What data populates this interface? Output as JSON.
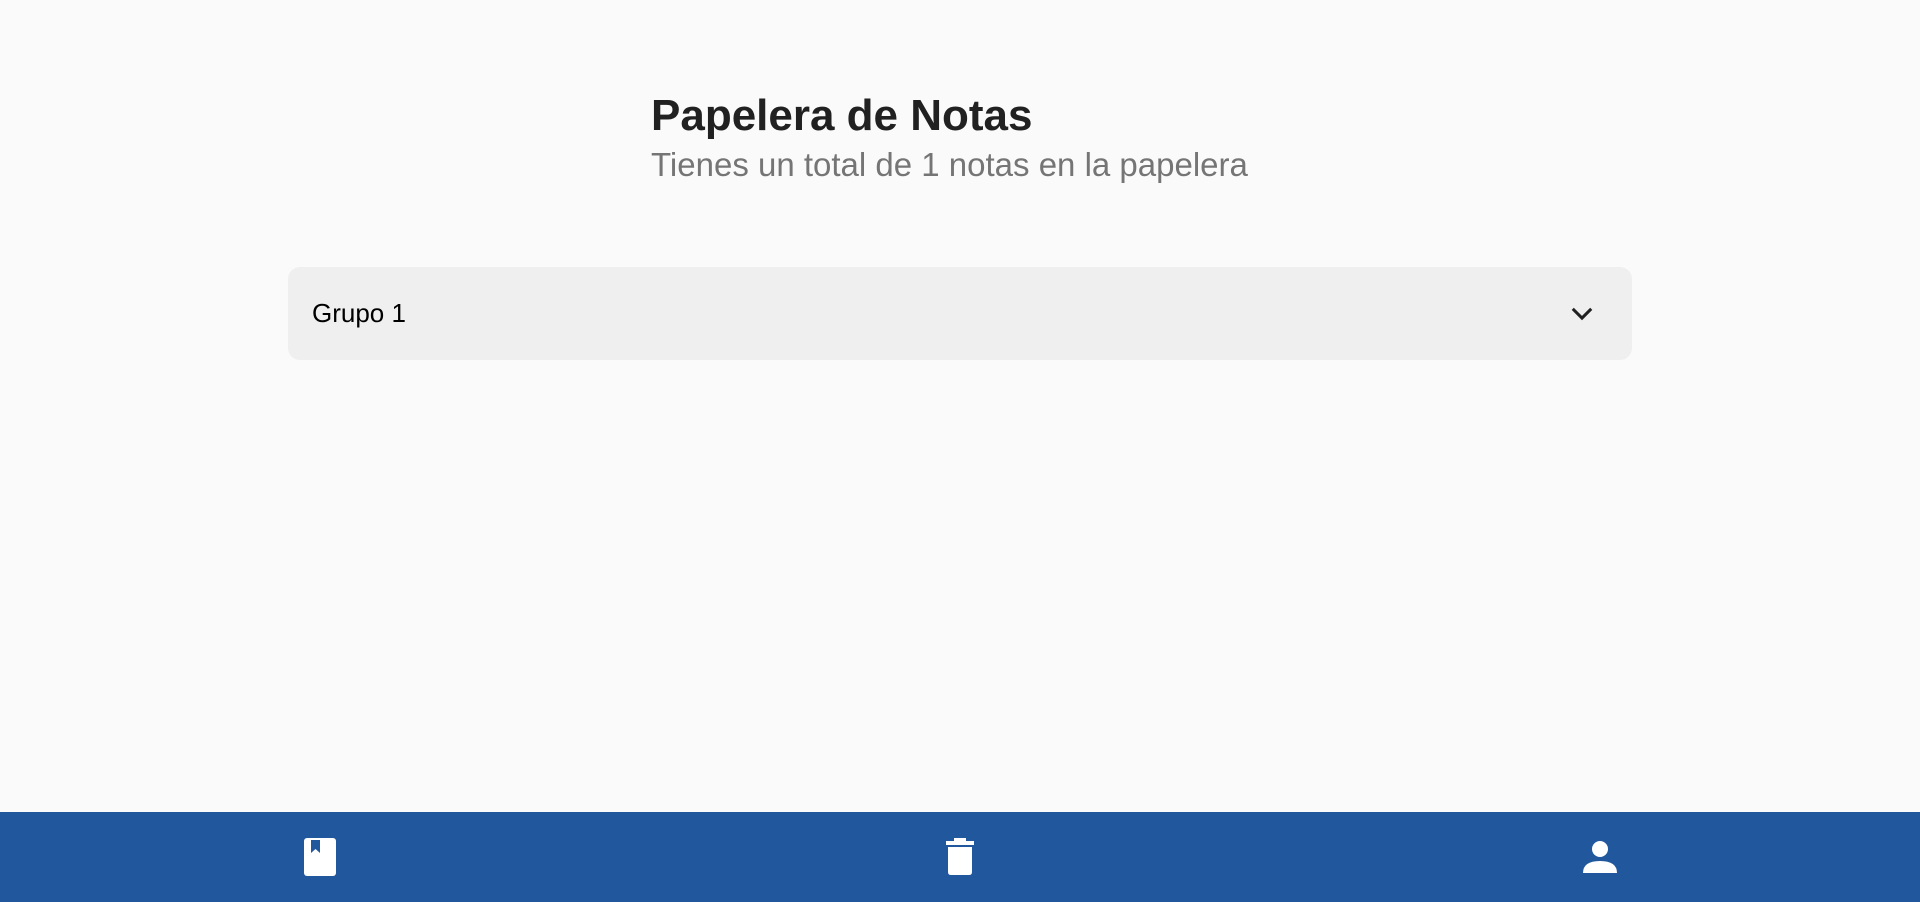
{
  "header": {
    "title": "Papelera de Notas",
    "subtitle": "Tienes un total de 1 notas en la papelera"
  },
  "groups": [
    {
      "title": "Grupo 1",
      "icon": "chevron-down-icon",
      "expanded": false
    }
  ],
  "bottom_nav": {
    "items": [
      {
        "icon": "notebook-icon"
      },
      {
        "icon": "trash-icon"
      },
      {
        "icon": "person-icon"
      }
    ]
  },
  "colors": {
    "background": "#fafafa",
    "nav_background": "#21579c",
    "panel_background": "#efefef",
    "title": "#212121",
    "subtitle": "#757575",
    "icon": "#ffffff"
  }
}
